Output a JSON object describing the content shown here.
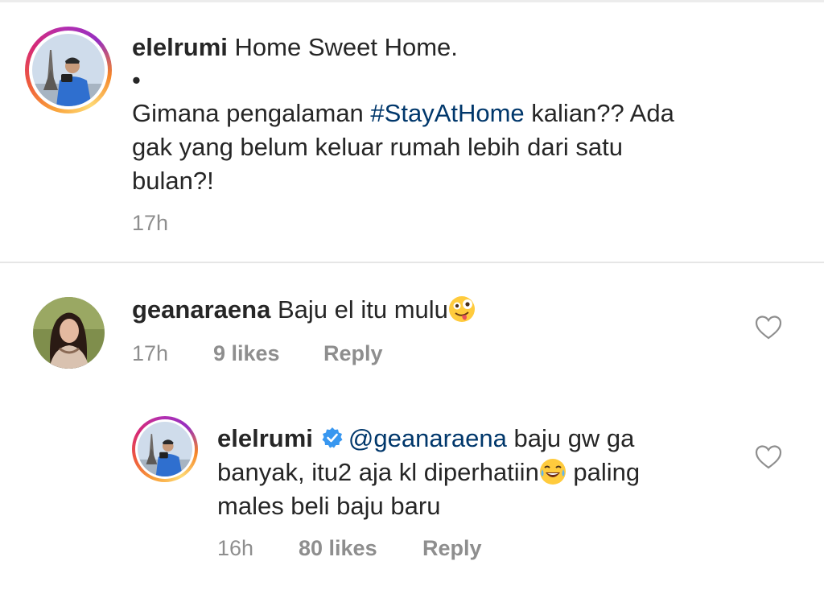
{
  "post": {
    "username": "elelrumi",
    "caption_line1": "Home Sweet Home.",
    "bullet": "•",
    "line2_before": "Gimana pengalaman ",
    "hashtag": "#StayAtHome",
    "line2_after": " kalian?? Ada",
    "line3": "gak yang belum keluar rumah lebih dari satu",
    "line4": "bulan?!",
    "time": "17h"
  },
  "comments": [
    {
      "username": "geanaraena",
      "text": "Baju el itu mulu",
      "emoji": "crazy-face",
      "time": "17h",
      "likes": "9 likes",
      "reply_label": "Reply"
    },
    {
      "username": "elelrumi",
      "verified": true,
      "mention": "@geanaraena",
      "line1_after": " baju gw ga",
      "line2": "banyak, itu2 aja kl diperhatiin",
      "emoji": "tears-of-joy",
      "line2_after": " paling",
      "line3": "males beli baju baru",
      "time": "16h",
      "likes": "80 likes",
      "reply_label": "Reply"
    }
  ],
  "colors": {
    "text": "#262626",
    "muted": "#8e8e8e",
    "hashtag": "#00376b",
    "verified": "#3897f0"
  }
}
